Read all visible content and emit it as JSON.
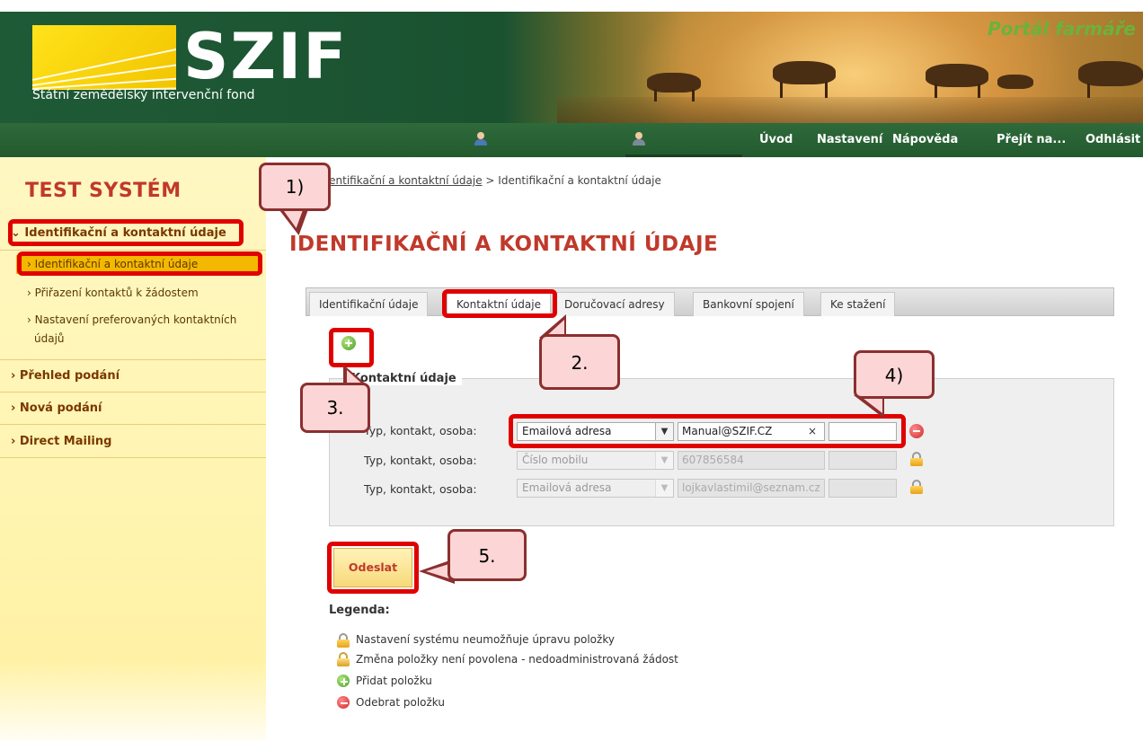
{
  "header": {
    "logo_text": "SZIF",
    "logo_subtitle": "Státní zemědělský intervenční fond",
    "portal_title": "Portál farmáře",
    "nav": [
      "Úvod",
      "Nastavení",
      "Nápověda",
      "Přejít na...",
      "Odhlásit"
    ]
  },
  "sidebar": {
    "system_title": "TEST SYSTÉM",
    "items": [
      {
        "label": "Identifikační a kontaktní údaje",
        "expanded": true
      },
      {
        "label": "Identifikační a kontaktní údaje",
        "active": true
      },
      {
        "label": "Přiřazení kontaktů k žádostem"
      },
      {
        "label": "Nastavení preferovaných kontaktních"
      },
      {
        "label": "údajů"
      },
      {
        "label": "Přehled podání"
      },
      {
        "label": "Nová podání"
      },
      {
        "label": "Direct Mailing"
      }
    ]
  },
  "breadcrumb": {
    "link": "Identifikační a kontaktní údaje",
    "separator": " > ",
    "current": "Identifikační a kontaktní údaje"
  },
  "page_title": "IDENTIFIKAČNÍ A KONTAKTNÍ ÚDAJE",
  "tabs": [
    "Identifikační údaje",
    "Kontaktní údaje",
    "Doručovací adresy",
    "Bankovní spojení",
    "Ke stažení"
  ],
  "fieldset": {
    "legend": "Kontaktní údaje",
    "row_label": "Typ, kontakt, osoba:",
    "rows": [
      {
        "type": "Emailová adresa",
        "contact": "Manual@SZIF.CZ",
        "person": "",
        "clear": "×"
      },
      {
        "type": "Číslo mobilu",
        "contact": "607856584",
        "person": ""
      },
      {
        "type": "Emailová adresa",
        "contact": "lojkavlastimil@seznam.cz",
        "person": ""
      }
    ]
  },
  "submit_label": "Odeslat",
  "legend": {
    "title": "Legenda:",
    "items": [
      "Nastavení systému neumožňuje úpravu položky",
      "Změna položky není povolena - nedoadministrovaná žádost",
      "Přidat položku",
      "Odebrat položku"
    ]
  },
  "callouts": [
    "1)",
    "2.",
    "3.",
    "4)",
    "5."
  ],
  "colors": {
    "accent_red": "#c0392b",
    "highlight": "#e00000",
    "nav_green": "#225a2e",
    "sidebar_yellow": "#fff4b0"
  }
}
